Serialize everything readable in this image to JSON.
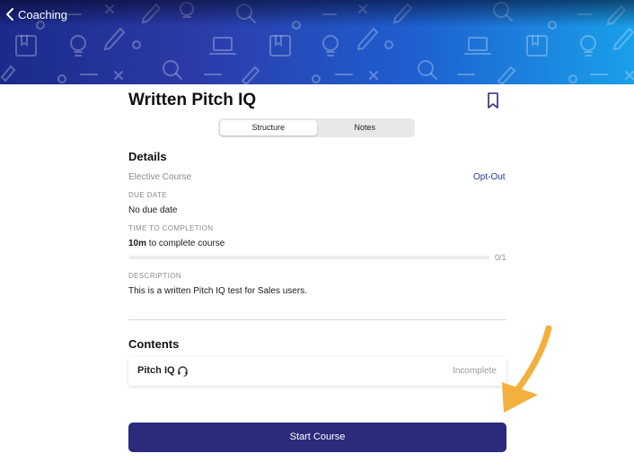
{
  "header": {
    "back_label": "Coaching"
  },
  "course": {
    "title": "Written Pitch IQ"
  },
  "tabs": [
    {
      "label": "Structure",
      "active": true
    },
    {
      "label": "Notes",
      "active": false
    }
  ],
  "details": {
    "heading": "Details",
    "course_type": "Elective Course",
    "opt_out_label": "Opt-Out",
    "due_date_label": "DUE DATE",
    "due_date_value": "No due date",
    "time_label": "TIME TO COMPLETION",
    "time_value_bold": "10m",
    "time_value_rest": " to complete course",
    "progress_text": "0/1",
    "progress_fraction": 0,
    "description_label": "DESCRIPTION",
    "description_value": "This is a written Pitch IQ test for Sales users."
  },
  "contents": {
    "heading": "Contents",
    "items": [
      {
        "name": "Pitch IQ",
        "icon": "headset-icon",
        "status": "Incomplete"
      }
    ]
  },
  "actions": {
    "start_label": "Start Course"
  },
  "colors": {
    "accent": "#2b2a7c",
    "link": "#2a3a9a",
    "annotation_arrow": "#f2b13e"
  }
}
